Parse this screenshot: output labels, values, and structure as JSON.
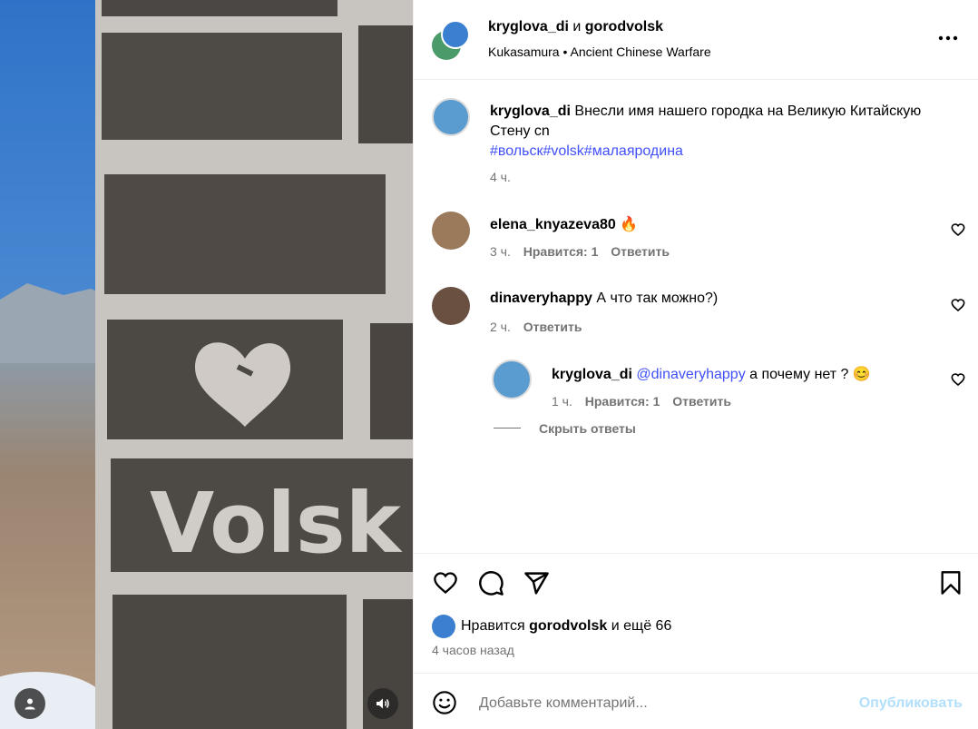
{
  "header": {
    "user1": "kryglova_di",
    "joiner": "и",
    "user2": "gorodvolsk",
    "audio": "Kukasamura",
    "separator": "•",
    "song": "Ancient Chinese Warfare"
  },
  "caption": {
    "username": "kryglova_di",
    "text": "Внесли имя нашего городка на Великую Китайскую Стену",
    "flag": "cn",
    "hashtags": "#вольск#volsk#малаяродина",
    "time": "4 ч."
  },
  "comments": [
    {
      "username": "elena_knyazeva80",
      "text": "🔥",
      "time": "3 ч.",
      "likes": "Нравится: 1",
      "reply": "Ответить"
    },
    {
      "username": "dinaveryhappy",
      "text": "А что так можно?)",
      "time": "2 ч.",
      "reply": "Ответить"
    }
  ],
  "reply_comment": {
    "username": "kryglova_di",
    "mention": "@dinaveryhappy",
    "text": "а почему нет ? 😊",
    "time": "1 ч.",
    "likes": "Нравится: 1",
    "reply": "Ответить"
  },
  "hide_replies": "Скрыть ответы",
  "likes_line": {
    "prefix": "Нравится",
    "user": "gorodvolsk",
    "suffix": "и ещё 66"
  },
  "post_time": "4 часов назад",
  "composer": {
    "placeholder": "Добавьте комментарий...",
    "publish": "Опубликовать"
  },
  "image_text": "Volsk",
  "colors": {
    "link": "#4150f7",
    "publish": "#b2dffc",
    "muted": "#737373"
  },
  "icons": [
    "more-options-icon",
    "like-icon",
    "comment-icon",
    "share-icon",
    "save-icon",
    "emoji-icon",
    "user-tag-icon",
    "speaker-icon",
    "small-heart-icon"
  ]
}
